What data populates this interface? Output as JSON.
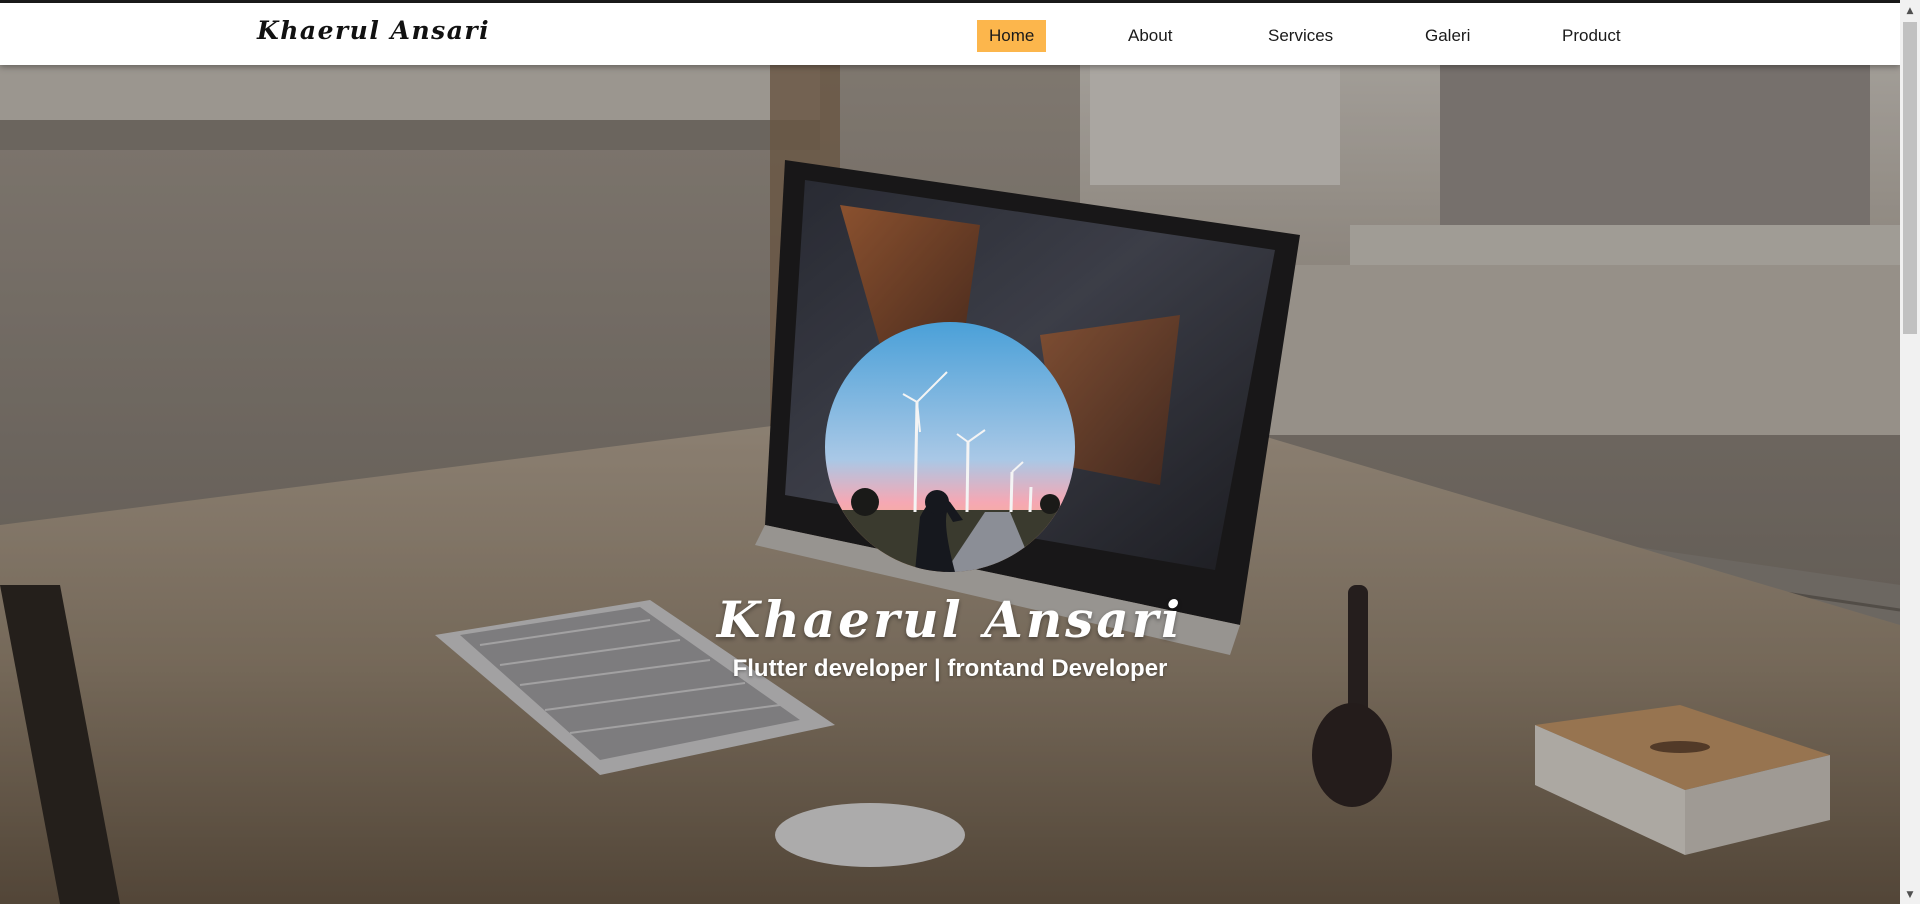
{
  "brand": {
    "name": "Khaerul Ansari"
  },
  "nav": {
    "items": [
      {
        "label": "Home",
        "active": true
      },
      {
        "label": "About",
        "active": false
      },
      {
        "label": "Services",
        "active": false
      },
      {
        "label": "Galeri",
        "active": false
      },
      {
        "label": "Product",
        "active": false
      }
    ]
  },
  "hero": {
    "name": "Khaerul Ansari",
    "subtitle": "Flutter developer | frontand Developer",
    "background_image": "desk-with-imac-keyboard-mouse-photo",
    "avatar_image": "wind-turbines-sunset-person-photo"
  },
  "colors": {
    "nav_active": "#fcb64c",
    "nav_background": "#ffffff",
    "hero_text": "#ffffff"
  },
  "scrollbar": {
    "up_icon": "scroll-up-arrow-icon",
    "down_icon": "scroll-down-arrow-icon"
  }
}
